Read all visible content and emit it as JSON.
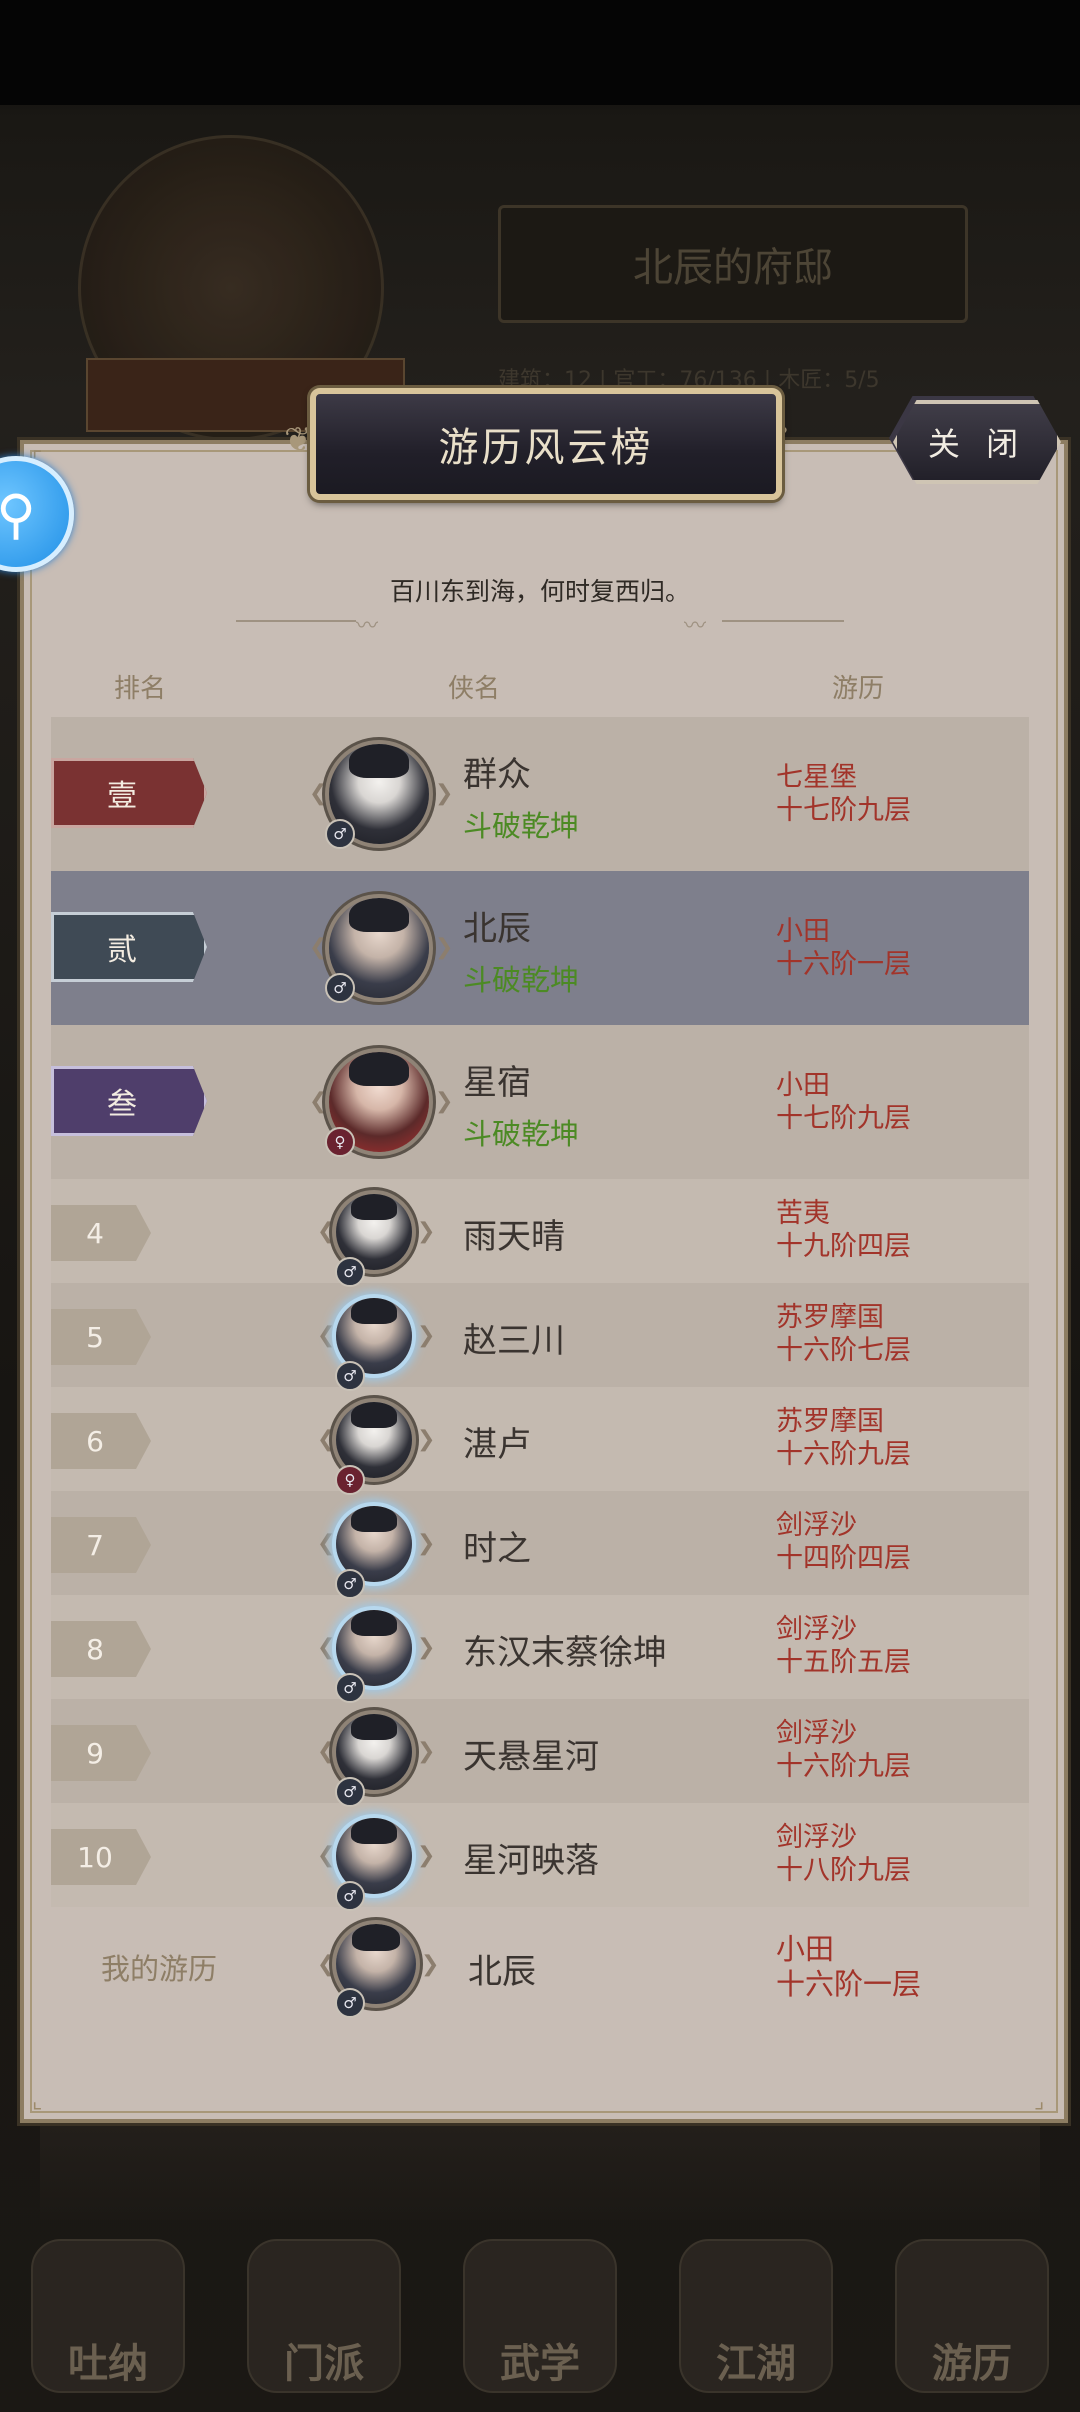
{
  "background": {
    "residence_title": "北辰的府邸",
    "stats": "建筑：12 | 官工：76/136 | 木匠：5/5",
    "tabs": [
      "吐纳",
      "门派",
      "武学",
      "江湖",
      "游历"
    ]
  },
  "dialog": {
    "title": "游历风云榜",
    "close_label": "关 闭",
    "subtitle": "百川东到海，何时复西归。",
    "columns": {
      "rank": "排名",
      "name": "侠名",
      "travel": "游历"
    }
  },
  "rankings": [
    {
      "rank": "壹",
      "name": "群众",
      "sect": "斗破乾坤",
      "place": "七星堡",
      "level": "十七阶九层",
      "gender": "♂",
      "avatar": "masked"
    },
    {
      "rank": "贰",
      "name": "北辰",
      "sect": "斗破乾坤",
      "place": "小田",
      "level": "十六阶一层",
      "gender": "♂",
      "avatar": "normal"
    },
    {
      "rank": "叁",
      "name": "星宿",
      "sect": "斗破乾坤",
      "place": "小田",
      "level": "十七阶九层",
      "gender": "♀",
      "avatar": "female"
    },
    {
      "rank": "4",
      "name": "雨天晴",
      "place": "苦夷",
      "level": "十九阶四层",
      "gender": "♂",
      "avatar": "masked"
    },
    {
      "rank": "5",
      "name": "赵三川",
      "place": "苏罗摩国",
      "level": "十六阶七层",
      "gender": "♂",
      "avatar": "frost"
    },
    {
      "rank": "6",
      "name": "湛卢",
      "place": "苏罗摩国",
      "level": "十六阶九层",
      "gender": "♀",
      "avatar": "masked"
    },
    {
      "rank": "7",
      "name": "时之",
      "place": "剑浮沙",
      "level": "十四阶四层",
      "gender": "♂",
      "avatar": "frost"
    },
    {
      "rank": "8",
      "name": "东汉末蔡徐坤",
      "place": "剑浮沙",
      "level": "十五阶五层",
      "gender": "♂",
      "avatar": "frost"
    },
    {
      "rank": "9",
      "name": "天悬星河",
      "place": "剑浮沙",
      "level": "十六阶九层",
      "gender": "♂",
      "avatar": "masked"
    },
    {
      "rank": "10",
      "name": "星河映落",
      "place": "剑浮沙",
      "level": "十八阶九层",
      "gender": "♂",
      "avatar": "frost"
    }
  ],
  "my_record": {
    "label": "我的游历",
    "name": "北辰",
    "place": "小田",
    "level": "十六阶一层",
    "gender": "♂"
  },
  "colors": {
    "rank1": "#7a3232",
    "rank2": "#3f4a55",
    "rank3": "#4f3e6b",
    "sect_text": "#4c8a24",
    "travel_text": "#a2342a",
    "my_row_highlight": "#7e7f8c"
  },
  "icons": {
    "floating_button": "search-assistant-icon",
    "gender_male": "male-icon",
    "gender_female": "female-icon"
  }
}
